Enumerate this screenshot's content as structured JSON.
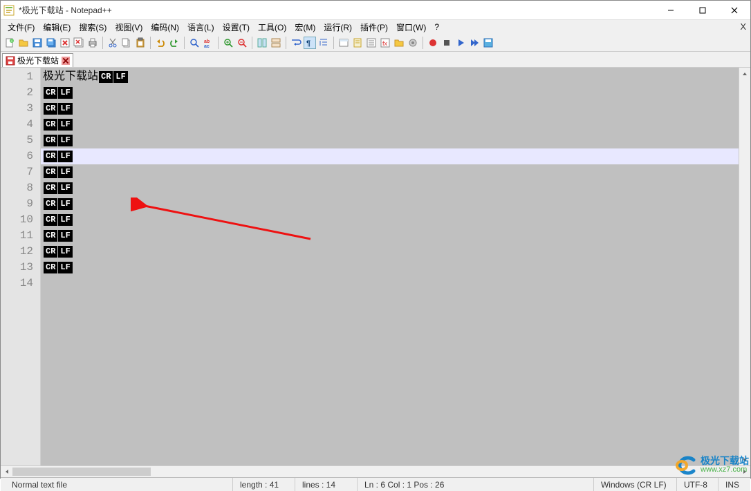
{
  "window": {
    "title": "*极光下载站 - Notepad++"
  },
  "menu": {
    "items": [
      "文件(F)",
      "编辑(E)",
      "搜索(S)",
      "视图(V)",
      "编码(N)",
      "语言(L)",
      "设置(T)",
      "工具(O)",
      "宏(M)",
      "运行(R)",
      "插件(P)",
      "窗口(W)",
      "?"
    ]
  },
  "tab": {
    "label": "极光下载站"
  },
  "editor": {
    "total_lines": 14,
    "highlight_line": 6,
    "lines": [
      {
        "n": 1,
        "text": "极光下载站",
        "eol": true
      },
      {
        "n": 2,
        "text": "",
        "eol": true
      },
      {
        "n": 3,
        "text": "",
        "eol": true
      },
      {
        "n": 4,
        "text": "",
        "eol": true
      },
      {
        "n": 5,
        "text": "",
        "eol": true
      },
      {
        "n": 6,
        "text": "",
        "eol": true
      },
      {
        "n": 7,
        "text": "",
        "eol": true
      },
      {
        "n": 8,
        "text": "",
        "eol": true
      },
      {
        "n": 9,
        "text": "",
        "eol": true
      },
      {
        "n": 10,
        "text": "",
        "eol": true
      },
      {
        "n": 11,
        "text": "",
        "eol": true
      },
      {
        "n": 12,
        "text": "",
        "eol": true
      },
      {
        "n": 13,
        "text": "",
        "eol": true
      },
      {
        "n": 14,
        "text": "",
        "eol": false
      }
    ],
    "eol_labels": {
      "cr": "CR",
      "lf": "LF"
    }
  },
  "status": {
    "filetype": "Normal text file",
    "length_label": "length : 41",
    "lines_label": "lines : 14",
    "pos_label": "Ln : 6    Col : 1    Pos : 26",
    "eol": "Windows (CR LF)",
    "encoding": "UTF-8",
    "mode": "INS"
  },
  "watermark": {
    "title": "极光下载站",
    "url": "www.xz7.com"
  }
}
